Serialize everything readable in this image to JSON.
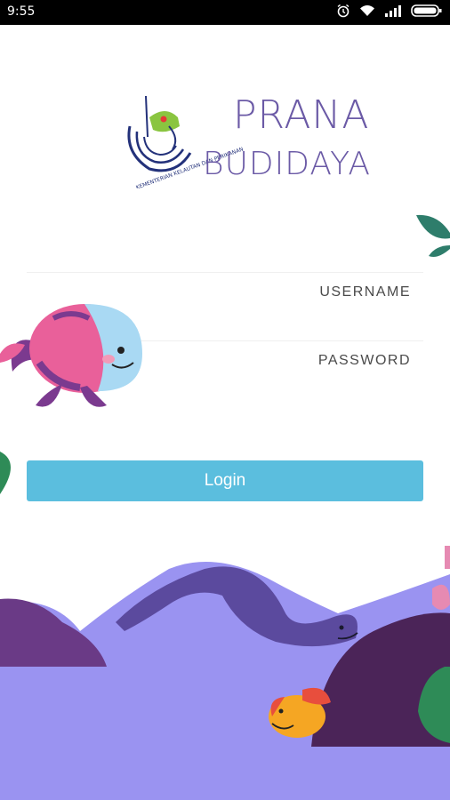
{
  "status_bar": {
    "time": "9:55"
  },
  "brand": {
    "line1": "PRANA",
    "line2": "BUDIDAYA",
    "ministry_logo_text": "KEMENTERIAN KELAUTAN DAN PERIKANAN"
  },
  "form": {
    "username_placeholder": "USERNAME",
    "password_placeholder": "PASSWORD",
    "login_label": "Login"
  },
  "colors": {
    "accent": "#5bbede",
    "brand": "#6b5aa6",
    "sea": "#9a93f1"
  },
  "icons": [
    "alarm-icon",
    "wifi-icon",
    "signal-icon",
    "battery-icon"
  ]
}
